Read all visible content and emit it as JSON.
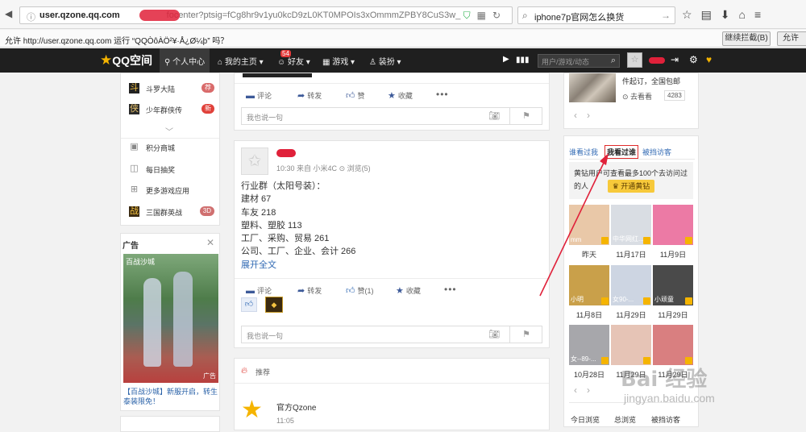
{
  "browser": {
    "url_domain": "user.qzone.qq.com",
    "url_tail": "focenter?ptsig=fCg8hr9v1yu0kcD9zL0KT0MPOIs3xOmmmZPBY8CuS3w_",
    "search_value": "iphone7p官网怎么换货"
  },
  "notification": {
    "text": "允许 http://user.qzone.qq.com 运行 “QQÒôÀÖ²¥·Å¿Ø¼þ” 吗？",
    "continue_label": "继续拦截(B)",
    "allow_label": "允许"
  },
  "nav": {
    "logo": "QQ空间",
    "items": [
      {
        "label": "个人中心",
        "icon": "person-icon"
      },
      {
        "label": "我的主页",
        "icon": "home-icon"
      },
      {
        "label": "好友",
        "icon": "friends-icon"
      },
      {
        "label": "游戏",
        "icon": "grid-icon"
      },
      {
        "label": "装扮",
        "icon": "shirt-icon"
      }
    ],
    "friends_badge": "54",
    "search_placeholder": "用户/游戏/动态"
  },
  "sidebar": {
    "items": [
      {
        "label": "斗罗大陆",
        "badge": "荐",
        "icon": "game-icon"
      },
      {
        "label": "少年群侠传",
        "badge": "新",
        "icon": "game-icon"
      },
      {
        "label": "积分商城",
        "badge": "",
        "icon": "shop-icon"
      },
      {
        "label": "每日抽奖",
        "badge": "",
        "icon": "gift-icon"
      },
      {
        "label": "更多游戏应用",
        "badge": "",
        "icon": "apps-icon"
      },
      {
        "label": "三国群英战",
        "badge": "3D",
        "icon": "game-icon"
      }
    ]
  },
  "ad": {
    "title": "广告",
    "image_title": "百战沙城",
    "image_tag": "广告",
    "caption": "【百战沙城】新服开启，转生泰装限免！"
  },
  "feed": {
    "actions": {
      "comment": "评论",
      "share": "转发",
      "like": "赞",
      "like_count": "赞(1)",
      "fav": "收藏"
    },
    "comment_placeholder": "我也说一句",
    "post": {
      "time": "10:30",
      "source": "来自 小米4C",
      "views": "浏览(5)",
      "lines": [
        "行业群（太阳号装）：",
        "建材 67",
        "车友 218",
        "塑料、塑胶 113",
        "工厂、采购、贸易 261",
        "公司、工厂、企业、会计 266"
      ],
      "expand": "展开全文"
    },
    "recommend": {
      "label": "推荐",
      "name": "官方Qzone",
      "time": "11:05"
    }
  },
  "right_top": {
    "text1": "件起订，全国包邮",
    "text0": "",
    "view_label": "去看看",
    "view_count": "4283"
  },
  "visitors": {
    "tabs": [
      "谁看过我",
      "我看过谁",
      "被挡访客"
    ],
    "vip_text": "黄钻用户可查看最多100个去访问过的人",
    "vip_button": "开通黄钻",
    "cells": [
      {
        "name": "mm",
        "date": "昨天",
        "color": "#e9c8a8"
      },
      {
        "name": "中华网红...",
        "date": "11月17日",
        "color": "#d9dde3"
      },
      {
        "name": "",
        "date": "11月9日",
        "color": "#ec7aa5"
      },
      {
        "name": "小明",
        "date": "11月8日",
        "color": "#c9a04a"
      },
      {
        "name": "女90-...",
        "date": "11月29日",
        "color": "#cdd5e2"
      },
      {
        "name": "小顽童",
        "date": "11月29日",
        "color": "#4a4a4a"
      },
      {
        "name": "女--89-...",
        "date": "10月28日",
        "color": "#a7a7ab"
      },
      {
        "name": "",
        "date": "11月29日",
        "color": "#e6c4b6"
      },
      {
        "name": "",
        "date": "11月29日",
        "color": "#d97f80"
      }
    ],
    "footer": [
      "今日浏览",
      "总浏览",
      "被挡访客"
    ]
  },
  "watermark": {
    "text": "Bai 经验",
    "sub": "jingyan.baidu.com"
  },
  "colors": {
    "nav_bg": "#1f1f1f",
    "accent_blue": "#2f68b3",
    "highlight_red": "#e02a2a",
    "vip_gold": "#f5b400"
  }
}
